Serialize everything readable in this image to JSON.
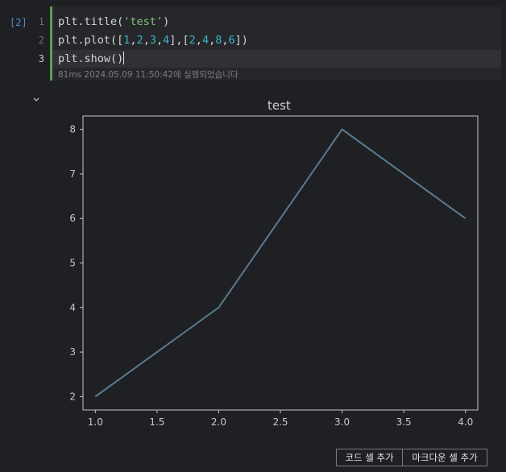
{
  "cell": {
    "execution_count": "[2]",
    "lines": [
      {
        "num": "1",
        "tokens": [
          {
            "t": "plt.title(",
            "c": ""
          },
          {
            "t": "'test'",
            "c": "tk-str"
          },
          {
            "t": ")",
            "c": ""
          }
        ]
      },
      {
        "num": "2",
        "tokens": [
          {
            "t": "plt.plot([",
            "c": ""
          },
          {
            "t": "1",
            "c": "tk-num"
          },
          {
            "t": ",",
            "c": ""
          },
          {
            "t": "2",
            "c": "tk-num"
          },
          {
            "t": ",",
            "c": ""
          },
          {
            "t": "3",
            "c": "tk-num"
          },
          {
            "t": ",",
            "c": ""
          },
          {
            "t": "4",
            "c": "tk-num"
          },
          {
            "t": "],[",
            "c": ""
          },
          {
            "t": "2",
            "c": "tk-num"
          },
          {
            "t": ",",
            "c": ""
          },
          {
            "t": "4",
            "c": "tk-num"
          },
          {
            "t": ",",
            "c": ""
          },
          {
            "t": "8",
            "c": "tk-num"
          },
          {
            "t": ",",
            "c": ""
          },
          {
            "t": "6",
            "c": "tk-num"
          },
          {
            "t": "])",
            "c": ""
          }
        ]
      },
      {
        "num": "3",
        "tokens": [
          {
            "t": "plt.show()",
            "c": ""
          }
        ]
      }
    ],
    "status": "81ms 2024.05.09 11:50:42에 실행되었습니다"
  },
  "output": {
    "collapse_icon": "chevron-down-icon"
  },
  "chart_data": {
    "type": "line",
    "title": "test",
    "x": [
      1,
      2,
      3,
      4
    ],
    "series": [
      {
        "values": [
          2,
          4,
          8,
          6
        ],
        "color": "#5b7a8f"
      }
    ],
    "xlim": [
      0.9,
      4.1
    ],
    "ylim": [
      1.7,
      8.3
    ],
    "xticks": [
      "1.0",
      "1.5",
      "2.0",
      "2.5",
      "3.0",
      "3.5",
      "4.0"
    ],
    "yticks": [
      "2",
      "3",
      "4",
      "5",
      "6",
      "7",
      "8"
    ],
    "grid": false,
    "axis_color": "#c9c9c9",
    "background": "#1f2023"
  },
  "footer": {
    "add_code_label": "코드 셀 추가",
    "add_markdown_label": "마크다운 셀 추가"
  }
}
